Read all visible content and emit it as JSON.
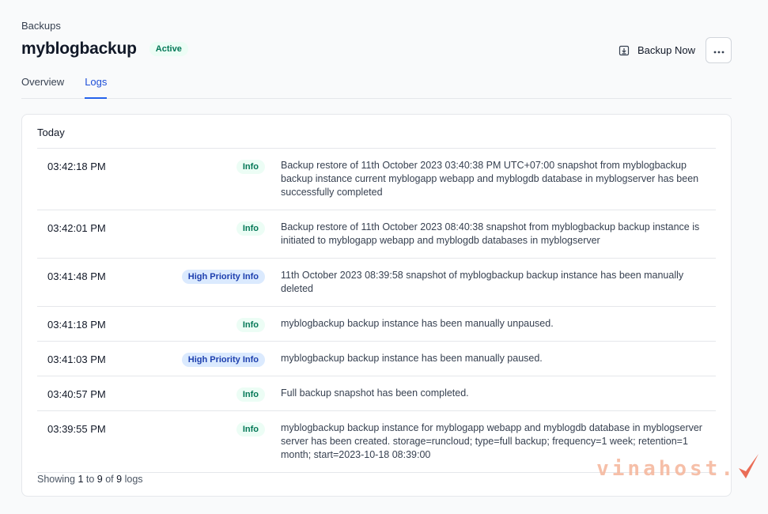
{
  "breadcrumb": "Backups",
  "page": {
    "title": "myblogbackup",
    "status": "Active"
  },
  "actions": {
    "backup_now": "Backup Now",
    "more_icon": "ellipsis-icon"
  },
  "tabs": [
    {
      "label": "Overview",
      "active": false
    },
    {
      "label": "Logs",
      "active": true
    }
  ],
  "logs": {
    "group_label": "Today",
    "rows": [
      {
        "time": "03:42:18 PM",
        "level": "Info",
        "level_type": "info",
        "message": "Backup restore of 11th October 2023 03:40:38 PM UTC+07:00 snapshot from myblogbackup backup instance current myblogapp webapp and myblogdb database in myblogserver has been successfully completed"
      },
      {
        "time": "03:42:01 PM",
        "level": "Info",
        "level_type": "info",
        "message": "Backup restore of 11th October 2023 08:40:38 snapshot from myblogbackup backup instance is initiated to myblogapp webapp and myblogdb databases in myblogserver"
      },
      {
        "time": "03:41:48 PM",
        "level": "High Priority Info",
        "level_type": "high",
        "message": "11th October 2023 08:39:58 snapshot of myblogbackup backup instance has been manually deleted"
      },
      {
        "time": "03:41:18 PM",
        "level": "Info",
        "level_type": "info",
        "message": "myblogbackup backup instance has been manually unpaused."
      },
      {
        "time": "03:41:03 PM",
        "level": "High Priority Info",
        "level_type": "high",
        "message": "myblogbackup backup instance has been manually paused."
      },
      {
        "time": "03:40:57 PM",
        "level": "Info",
        "level_type": "info",
        "message": "Full backup snapshot has been completed."
      },
      {
        "time": "03:39:55 PM",
        "level": "Info",
        "level_type": "info",
        "message": "myblogbackup backup instance for myblogapp webapp and myblogdb database in myblogserver server has been created. storage=runcloud; type=full backup; frequency=1 week; retention=1 month; start=2023-10-18 08:39:00"
      }
    ]
  },
  "pagination": {
    "prefix": "Showing",
    "from": "1",
    "to_word": "to",
    "to": "9",
    "of_word": "of",
    "total": "9",
    "suffix": "logs"
  },
  "watermark": {
    "text": "vinahost."
  },
  "colors": {
    "accent": "#2563eb",
    "info_bg": "#ecfdf5",
    "info_text": "#047857",
    "high_bg": "#dbeafe",
    "high_text": "#1e40af"
  }
}
